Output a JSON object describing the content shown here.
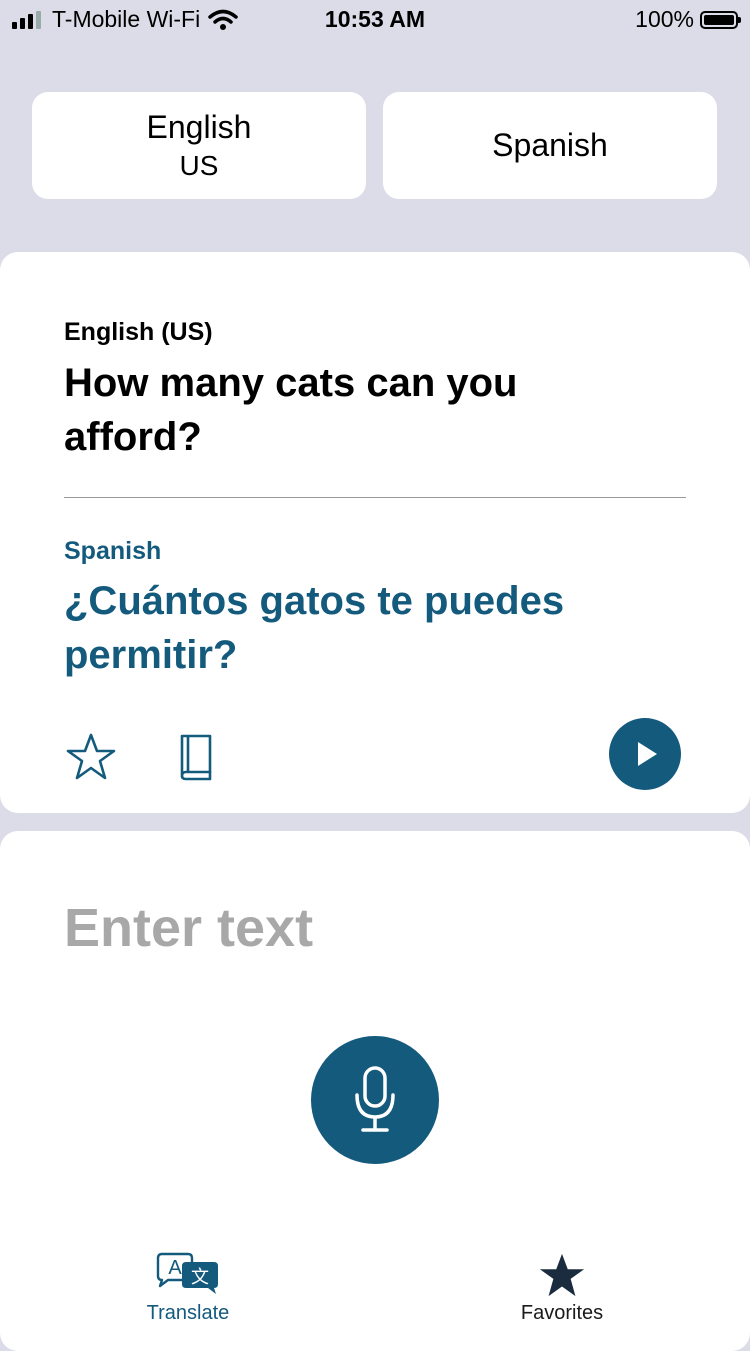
{
  "status_bar": {
    "carrier": "T-Mobile Wi-Fi",
    "time": "10:53 AM",
    "battery": "100%"
  },
  "languages": {
    "source": {
      "name": "English",
      "region": "US"
    },
    "target": {
      "name": "Spanish"
    }
  },
  "result": {
    "source_label": "English (US)",
    "source_text": "How many cats can you afford?",
    "target_label": "Spanish",
    "target_text": "¿Cuántos gatos te puedes permitir?"
  },
  "input": {
    "placeholder": "Enter text"
  },
  "tabs": [
    {
      "label": "Translate",
      "icon": "translate-icon",
      "active": true
    },
    {
      "label": "Favorites",
      "icon": "star-filled-icon",
      "active": false
    }
  ],
  "colors": {
    "accent": "#145a7d",
    "background": "#dcdce8",
    "placeholder": "#a8a8a8"
  }
}
